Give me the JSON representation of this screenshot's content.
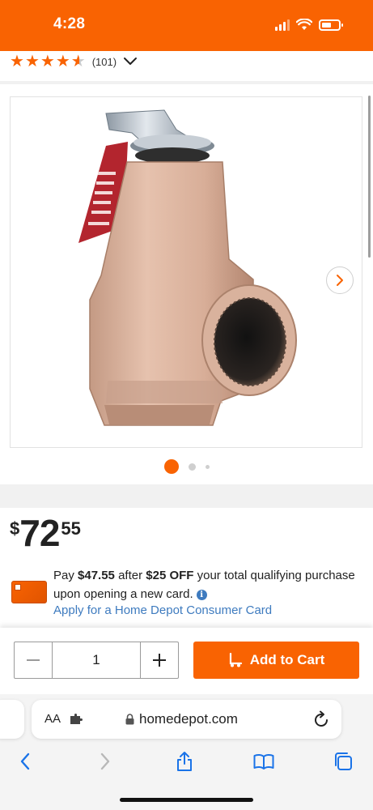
{
  "status_bar": {
    "time": "4:28"
  },
  "rating": {
    "review_count": "(101)",
    "stars": 4.5
  },
  "gallery": {
    "image_count": 3,
    "active_index": 0
  },
  "price": {
    "currency": "$",
    "dollars": "72",
    "cents": "55"
  },
  "promo": {
    "text_pay": "Pay ",
    "amount_after": "$47.55",
    "text_after": " after ",
    "discount": "$25 OFF",
    "text_rest": " your total qualifying purchase upon opening a new card.",
    "link": "Apply for a Home Depot Consumer Card"
  },
  "cart": {
    "quantity": "1",
    "add_label": "Add to Cart"
  },
  "browser": {
    "aa_label": "AA",
    "url": "homedepot.com"
  },
  "colors": {
    "brand": "#f96302",
    "link": "#3e7bbf"
  }
}
